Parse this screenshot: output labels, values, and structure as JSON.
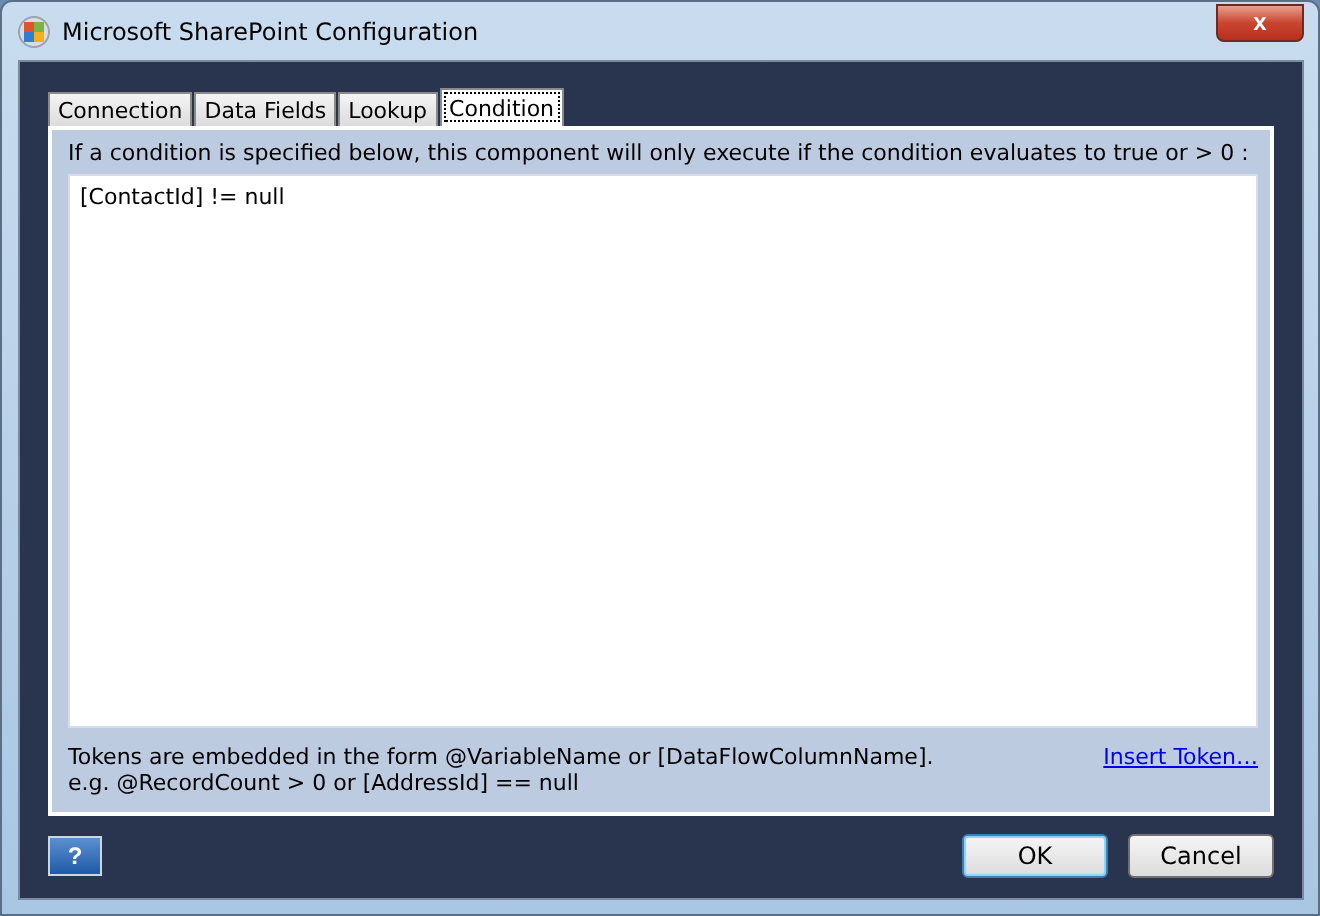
{
  "window": {
    "title": "Microsoft SharePoint Configuration",
    "close_glyph": "x"
  },
  "tabs": [
    {
      "label": "Connection",
      "selected": false
    },
    {
      "label": "Data Fields",
      "selected": false
    },
    {
      "label": "Lookup",
      "selected": false
    },
    {
      "label": "Condition",
      "selected": true
    }
  ],
  "condition": {
    "instruction": "If a condition is specified below, this component will only execute if the condition evaluates to true or > 0 :",
    "value": "[ContactId] != null"
  },
  "hints": [
    "Tokens are embedded in the form @VariableName or [DataFlowColumnName].",
    "e.g. @RecordCount > 0 or [AddressId] == null"
  ],
  "insert_link": "Insert Token…",
  "help_glyph": "?",
  "buttons": [
    {
      "label": "OK",
      "default": true
    },
    {
      "label": "Cancel",
      "default": false
    }
  ]
}
